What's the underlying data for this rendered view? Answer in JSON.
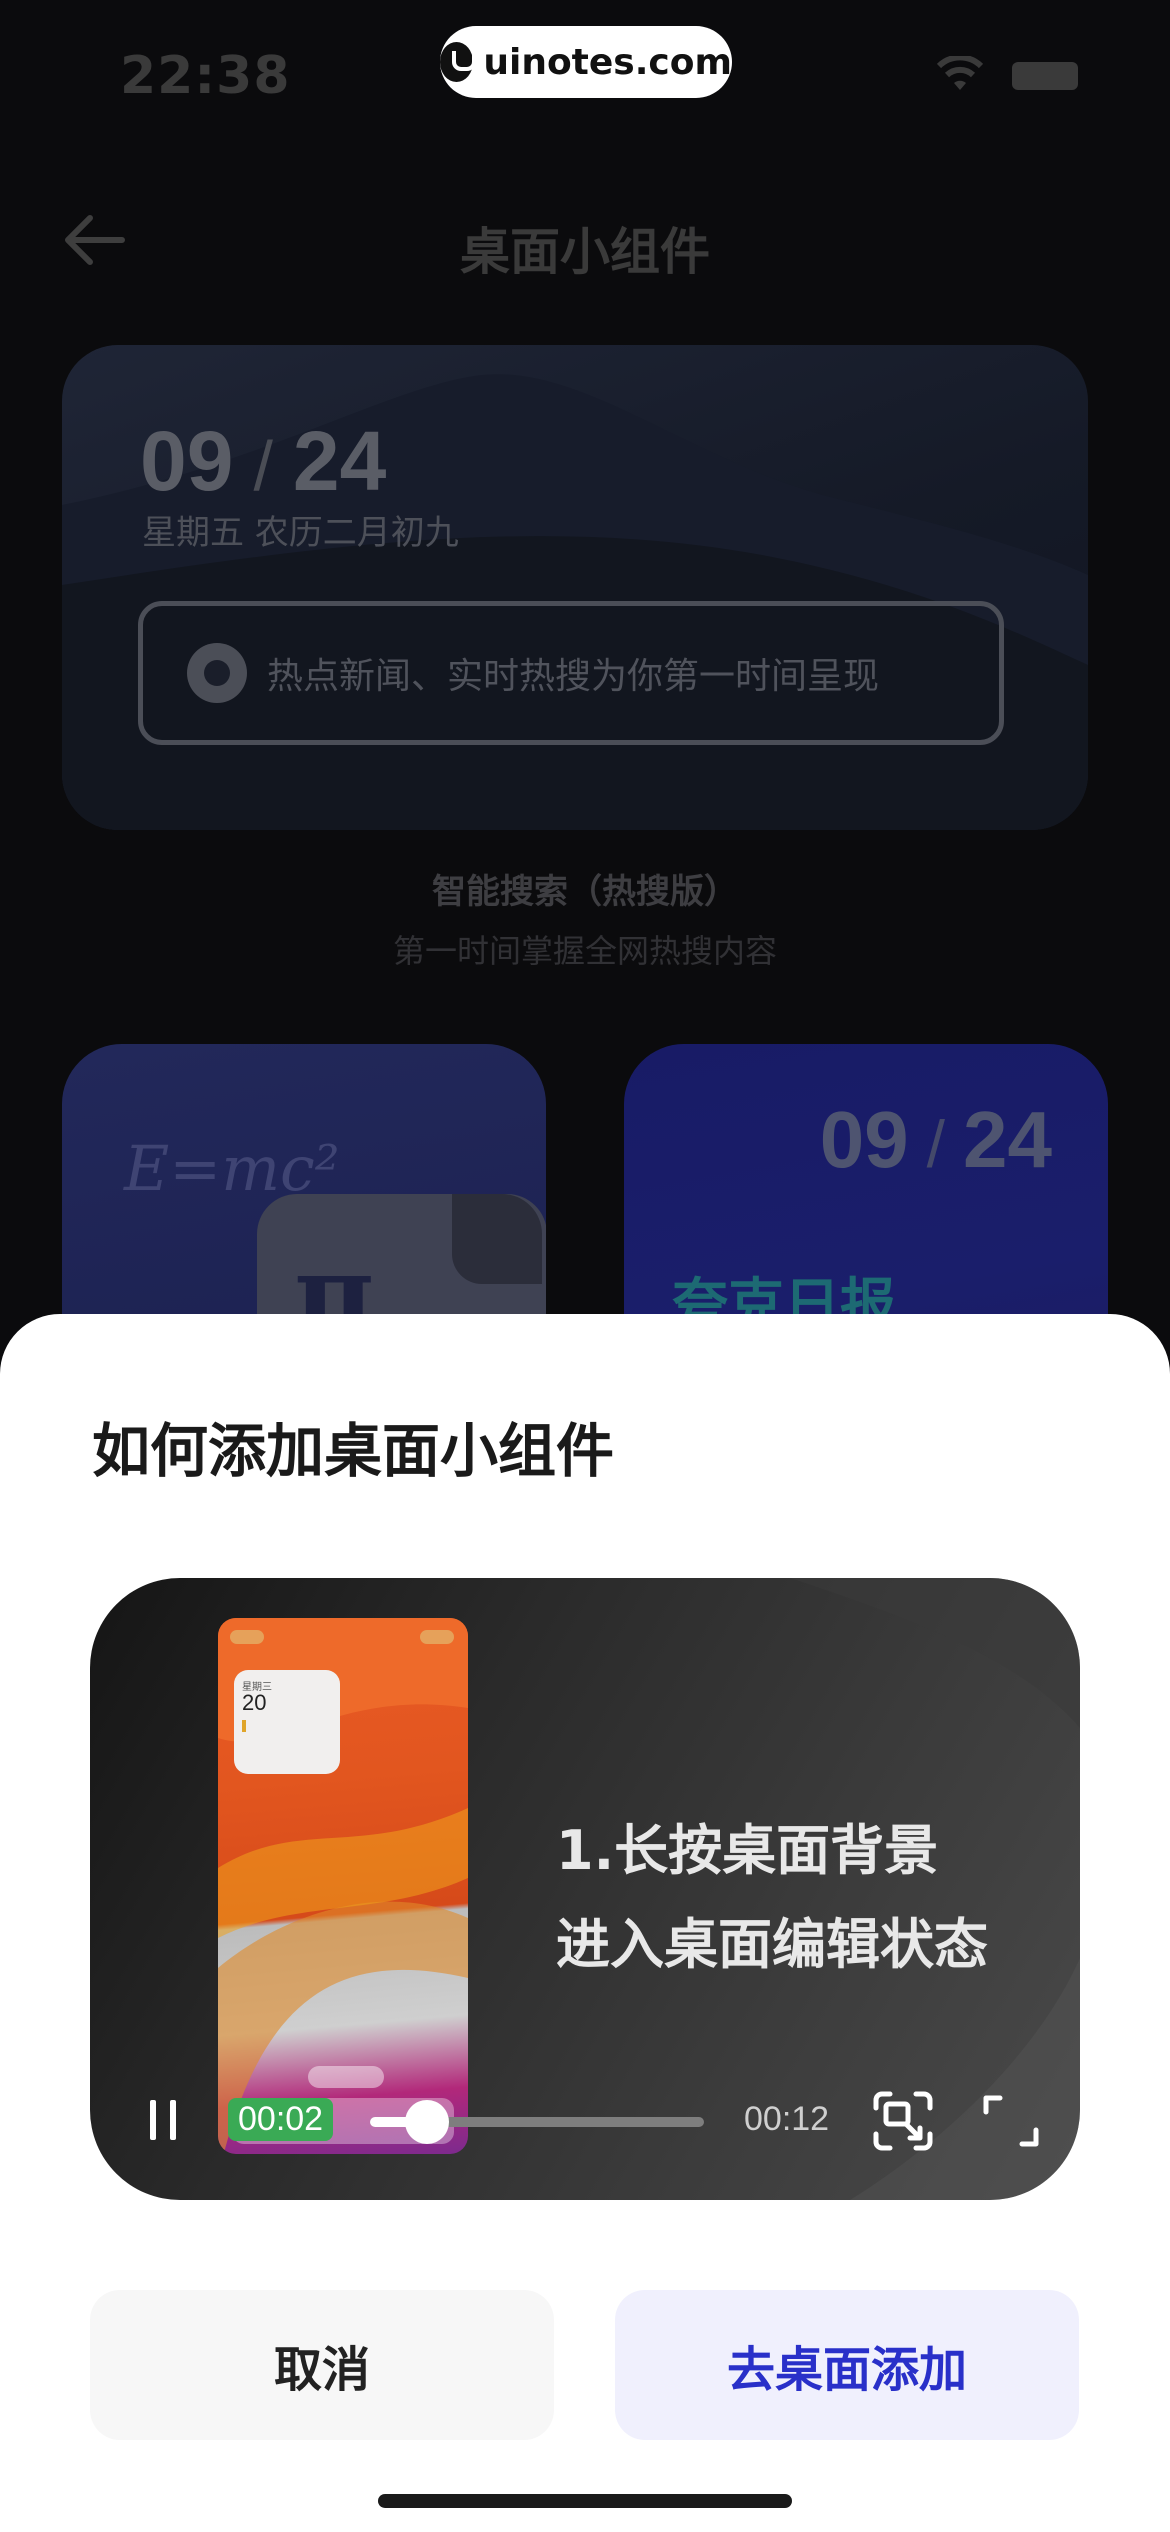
{
  "status_bar": {
    "time": "22:38",
    "watermark": "uinotes.com"
  },
  "nav": {
    "title": "桌面小组件"
  },
  "hero_widget": {
    "month": "09",
    "day": "24",
    "sub": "星期五  农历二月初九",
    "search_text": "热点新闻、实时热搜为你第一时间呈现"
  },
  "widget_info": {
    "name": "智能搜索（热搜版）",
    "desc": "第一时间掌握全网热搜内容"
  },
  "card_right": {
    "month": "09",
    "day": "24",
    "name": "夸克日报"
  },
  "card_left": {
    "formula": "E=mc²",
    "symbol": "π"
  },
  "sheet": {
    "title": "如何添加桌面小组件",
    "video": {
      "caption_line1": "1.长按桌面背景",
      "caption_line2": "进入桌面编辑状态",
      "current_time": "00:02",
      "duration": "00:12",
      "progress": 0.17,
      "phone_widget_day": "星期三",
      "phone_widget_num": "20"
    },
    "cancel_label": "取消",
    "add_label": "去桌面添加"
  },
  "colors": {
    "accent": "#2930c9",
    "sheet_bg": "#ffffff",
    "page_bg": "#0b0b0d"
  }
}
